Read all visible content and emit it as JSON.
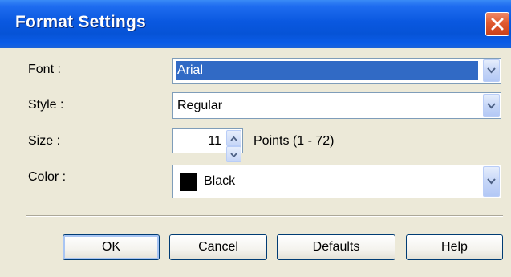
{
  "window": {
    "title": "Format Settings"
  },
  "fields": {
    "font": {
      "label": "Font :",
      "value": "Arial"
    },
    "style": {
      "label": "Style :",
      "value": "Regular"
    },
    "size": {
      "label": "Size :",
      "value": "11",
      "range_text": "Points (1 - 72)"
    },
    "color": {
      "label": "Color :",
      "value": "Black",
      "swatch": "#000000"
    }
  },
  "buttons": {
    "ok": "OK",
    "cancel": "Cancel",
    "defaults": "Defaults",
    "help": "Help"
  },
  "icons": {
    "close": "close-icon",
    "dropdown": "chevron-down-icon",
    "spin_up": "spin-up-icon",
    "spin_down": "spin-down-icon"
  },
  "colors": {
    "titlebar": "#0a58e0",
    "selection": "#316ac5",
    "dialog_bg": "#ece9d8",
    "close_button": "#e05a30"
  }
}
